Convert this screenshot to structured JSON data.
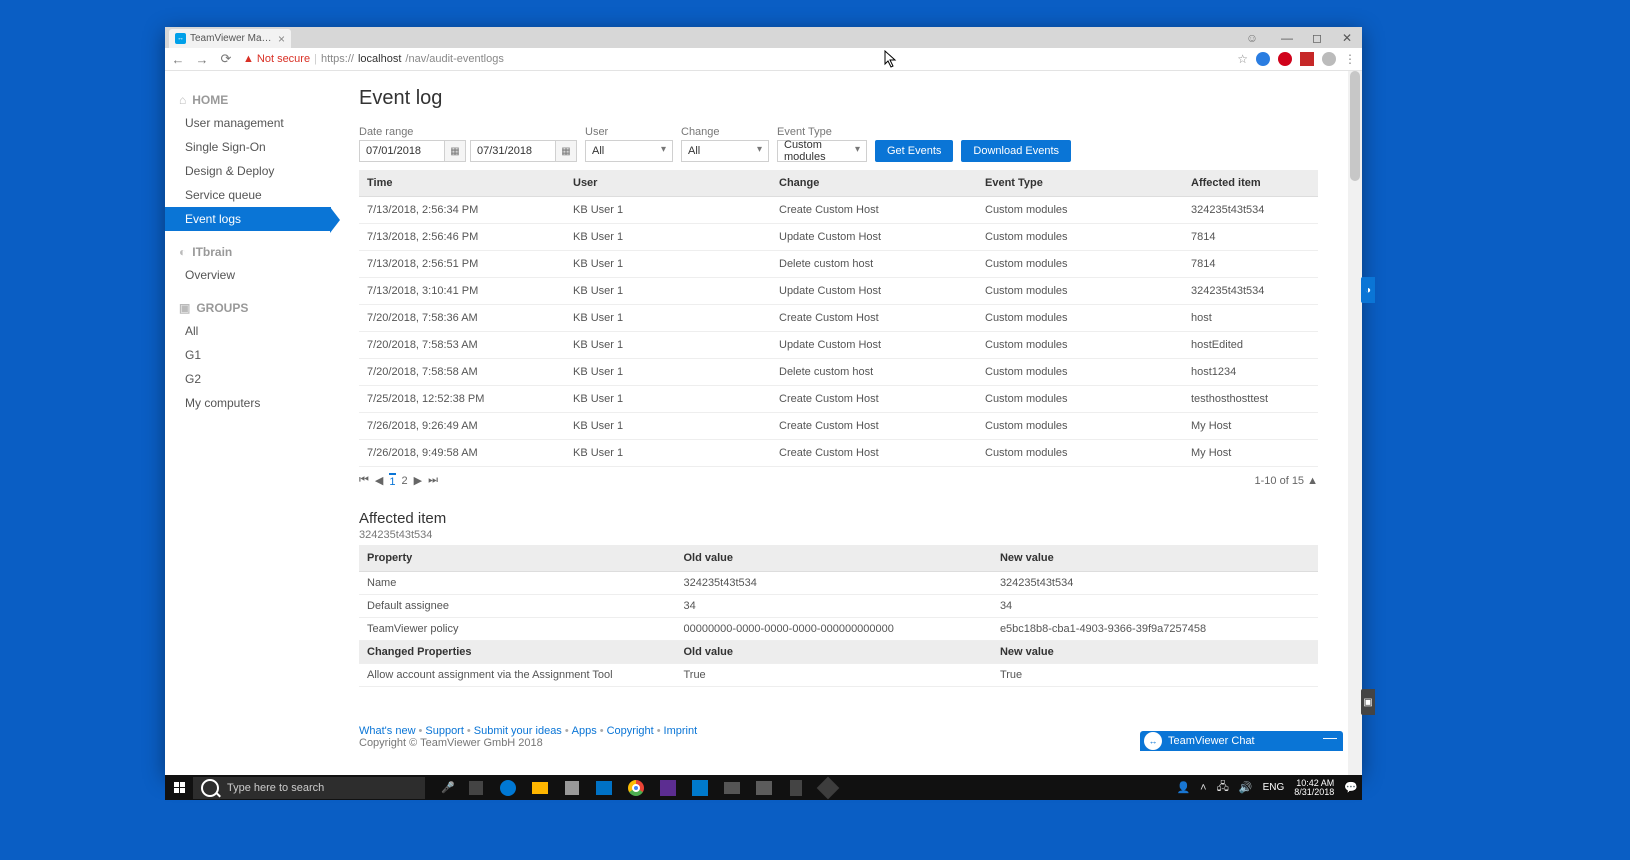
{
  "browser": {
    "tab_title": "TeamViewer Manageme",
    "url_prefix": "https://",
    "url_host": "localhost",
    "url_path": "/nav/audit-eventlogs",
    "security_label": "Not secure"
  },
  "sidebar": {
    "sections": [
      {
        "label": "HOME",
        "icon": "home",
        "items": [
          {
            "label": "User management"
          },
          {
            "label": "Single Sign-On"
          },
          {
            "label": "Design & Deploy"
          },
          {
            "label": "Service queue"
          },
          {
            "label": "Event logs",
            "active": true
          }
        ]
      },
      {
        "label": "ITbrain",
        "icon": "circle",
        "items": [
          {
            "label": "Overview"
          }
        ]
      },
      {
        "label": "GROUPS",
        "icon": "groups",
        "items": [
          {
            "label": "All"
          },
          {
            "label": "G1"
          },
          {
            "label": "G2"
          },
          {
            "label": "My computers"
          }
        ]
      }
    ]
  },
  "page": {
    "title": "Event log",
    "filters": {
      "date_range_label": "Date range",
      "date_from": "07/01/2018",
      "date_to": "07/31/2018",
      "user_label": "User",
      "user_value": "All",
      "change_label": "Change",
      "change_value": "All",
      "event_type_label": "Event Type",
      "event_type_value": "Custom modules",
      "get_button": "Get Events",
      "download_button": "Download Events"
    },
    "table": {
      "columns": [
        "Time",
        "User",
        "Change",
        "Event Type",
        "Affected item"
      ],
      "rows": [
        {
          "time": "7/13/2018, 2:56:34 PM",
          "user": "KB User 1",
          "change": "Create Custom Host",
          "etype": "Custom modules",
          "item": "324235t43t534"
        },
        {
          "time": "7/13/2018, 2:56:46 PM",
          "user": "KB User 1",
          "change": "Update Custom Host",
          "etype": "Custom modules",
          "item": "7814"
        },
        {
          "time": "7/13/2018, 2:56:51 PM",
          "user": "KB User 1",
          "change": "Delete custom host",
          "etype": "Custom modules",
          "item": "7814"
        },
        {
          "time": "7/13/2018, 3:10:41 PM",
          "user": "KB User 1",
          "change": "Update Custom Host",
          "etype": "Custom modules",
          "item": "324235t43t534"
        },
        {
          "time": "7/20/2018, 7:58:36 AM",
          "user": "KB User 1",
          "change": "Create Custom Host",
          "etype": "Custom modules",
          "item": "host"
        },
        {
          "time": "7/20/2018, 7:58:53 AM",
          "user": "KB User 1",
          "change": "Update Custom Host",
          "etype": "Custom modules",
          "item": "hostEdited"
        },
        {
          "time": "7/20/2018, 7:58:58 AM",
          "user": "KB User 1",
          "change": "Delete custom host",
          "etype": "Custom modules",
          "item": "host1234"
        },
        {
          "time": "7/25/2018, 12:52:38 PM",
          "user": "KB User 1",
          "change": "Create Custom Host",
          "etype": "Custom modules",
          "item": "testhosthosttest"
        },
        {
          "time": "7/26/2018, 9:26:49 AM",
          "user": "KB User 1",
          "change": "Create Custom Host",
          "etype": "Custom modules",
          "item": "My Host"
        },
        {
          "time": "7/26/2018, 9:49:58 AM",
          "user": "KB User 1",
          "change": "Create Custom Host",
          "etype": "Custom modules",
          "item": "My Host"
        }
      ]
    },
    "pager": {
      "first": "⏮",
      "prev": "◀",
      "page1": "1",
      "page2": "2",
      "next": "▶",
      "last": "⏭",
      "summary": "1-10 of 15 ▲"
    },
    "affected": {
      "title": "Affected item",
      "id": "324235t43t534",
      "header": [
        "Property",
        "Old value",
        "New value"
      ],
      "rows": [
        {
          "prop": "Name",
          "old": "324235t43t534",
          "new": "324235t43t534"
        },
        {
          "prop": "Default assignee",
          "old": "34",
          "new": "34"
        },
        {
          "prop": "TeamViewer policy",
          "old": "00000000-0000-0000-0000-000000000000",
          "new": "e5bc18b8-cba1-4903-9366-39f9a7257458"
        }
      ],
      "changed_header": [
        "Changed Properties",
        "Old value",
        "New value"
      ],
      "changed_rows": [
        {
          "prop": "Allow account assignment via the Assignment Tool",
          "old": "True",
          "new": "True"
        }
      ]
    }
  },
  "footer": {
    "links": [
      "What's new",
      "Support",
      "Submit your ideas",
      "Apps",
      "Copyright",
      "Imprint"
    ],
    "copyright": "Copyright © TeamViewer GmbH 2018"
  },
  "chat": {
    "label": "TeamViewer Chat"
  },
  "taskbar": {
    "search_placeholder": "Type here to search",
    "lang": "ENG",
    "time": "10:42 AM",
    "date": "8/31/2018"
  }
}
